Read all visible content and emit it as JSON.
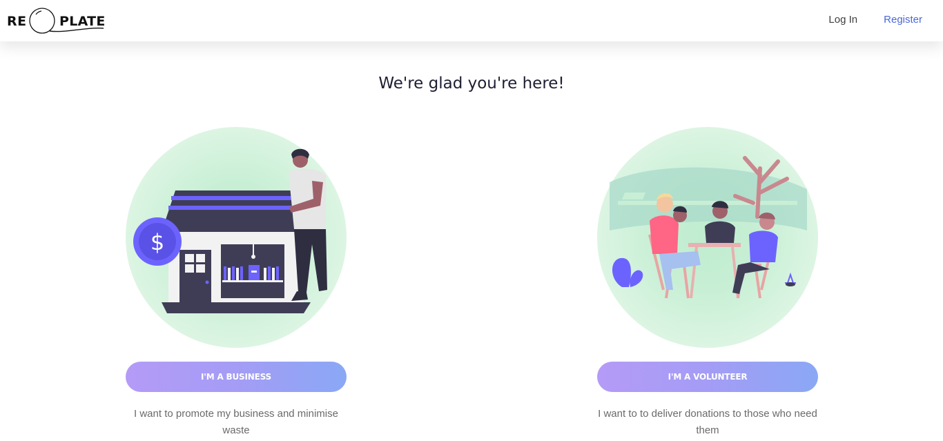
{
  "brand": {
    "logo_left": "RE",
    "logo_right": "PLATE"
  },
  "nav": {
    "login": "Log In",
    "register": "Register"
  },
  "heading": "We're glad you're here!",
  "cards": [
    {
      "button": "I'M A BUSINESS",
      "description": "I want to promote my business and minimise waste"
    },
    {
      "button": "I'M A VOLUNTEER",
      "description": "I want to to deliver donations to those who need them"
    }
  ],
  "colors": {
    "accent": "#4a67d6",
    "button_gradient_start": "#b49bf7",
    "button_gradient_end": "#8aa8f5",
    "illustration_purple": "#6c63ff",
    "illustration_dark": "#3f3d56",
    "circle_green": "#c8efd5"
  }
}
